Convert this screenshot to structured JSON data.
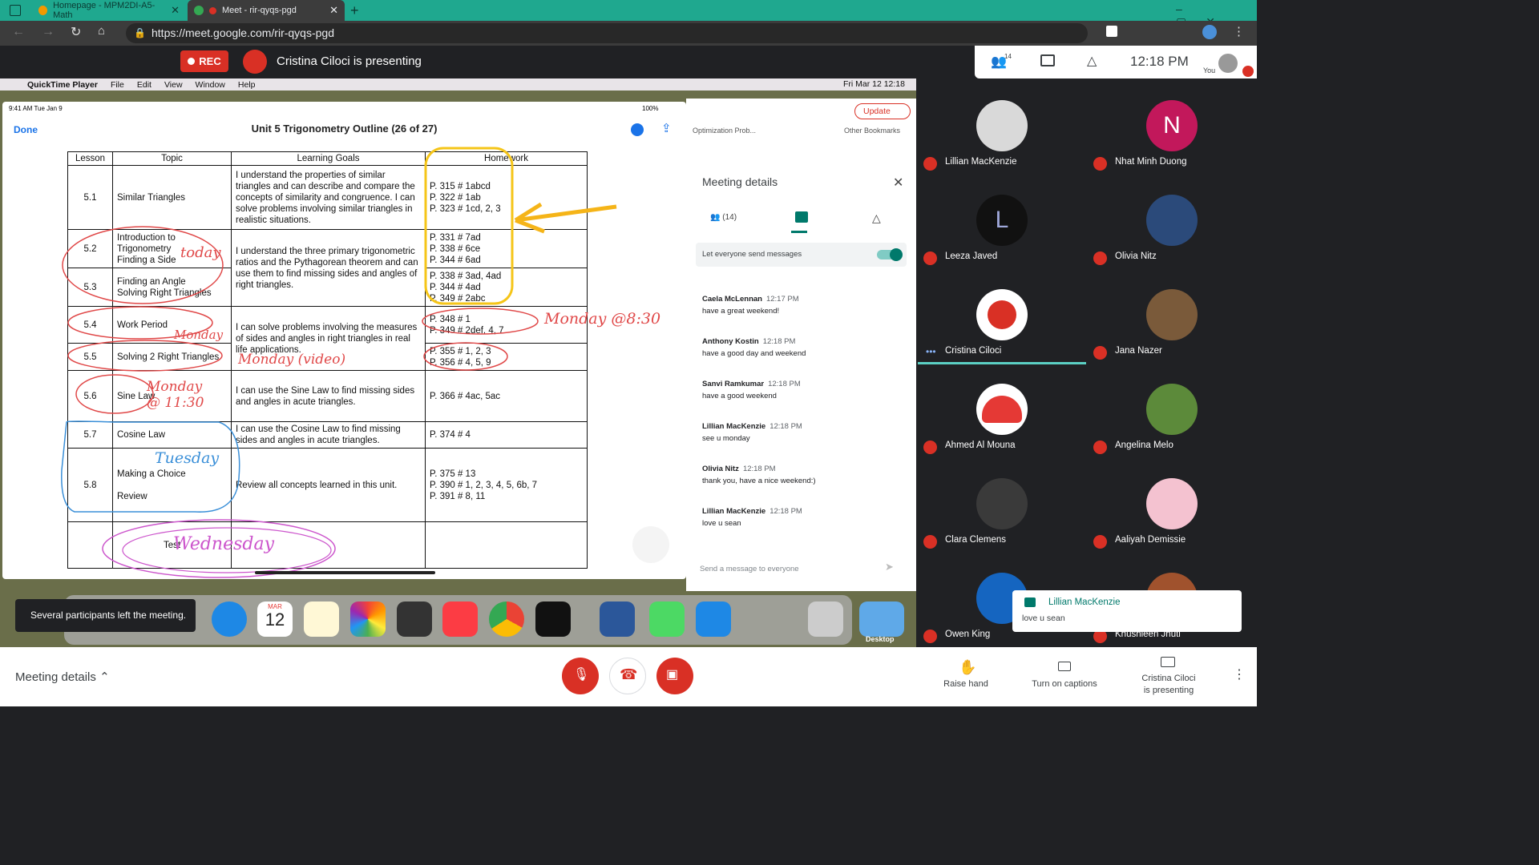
{
  "browser": {
    "tabs": [
      {
        "label": "Homepage - MPM2DI-A5-Math",
        "active": false
      },
      {
        "label": "Meet - rir-qyqs-pgd",
        "active": true
      }
    ],
    "url": "https://meet.google.com/rir-qyqs-pgd"
  },
  "meet_header": {
    "rec_label": "REC",
    "presenting_text": "Cristina Ciloci is presenting",
    "participant_count": "14",
    "time": "12:18 PM",
    "you_label": "You"
  },
  "mac_menubar": {
    "items": [
      "QuickTime Player",
      "File",
      "Edit",
      "View",
      "Window",
      "Help"
    ],
    "datetime": "Fri Mar 12  12:18"
  },
  "ipad": {
    "status_time": "9:41 AM",
    "status_date": "Tue Jan 9",
    "battery": "100%",
    "done_label": "Done",
    "doc_title": "Unit 5 Trigonometry Outline (26 of 27)"
  },
  "doc_table": {
    "headers": [
      "Lesson",
      "Topic",
      "Learning Goals",
      "Homework"
    ],
    "rows": [
      {
        "lesson": "5.1",
        "topic": "Similar Triangles",
        "goals": "I understand the properties of similar triangles and can describe and compare the concepts of similarity and congruence. I can solve problems involving similar triangles in realistic situations.",
        "homework": "P. 315 # 1abcd\nP. 322 # 1ab\nP. 323 # 1cd, 2, 3"
      },
      {
        "lesson": "5.2",
        "topic": "Introduction to Trigonometry\nFinding a Side",
        "goals": "I understand the three primary trigonometric ratios and the Pythagorean theorem and can use them to find missing sides and angles of right triangles.",
        "homework": "P. 331 # 7ad\nP. 338 # 6ce\nP. 344 # 6ad"
      },
      {
        "lesson": "5.3",
        "topic": "Finding an Angle\nSolving Right Triangles",
        "goals": "",
        "homework": "P. 338 # 3ad, 4ad\nP. 344 # 4ad\nP. 349 # 2abc"
      },
      {
        "lesson": "5.4",
        "topic": "Work Period",
        "goals": "I can solve problems involving the measures of sides and angles in right triangles in real life applications.",
        "homework": "P. 348 # 1\nP. 349 # 2def, 4, 7"
      },
      {
        "lesson": "5.5",
        "topic": "Solving 2 Right Triangles",
        "goals": "",
        "homework": "P. 355 # 1, 2, 3\nP. 356 # 4, 5, 9"
      },
      {
        "lesson": "5.6",
        "topic": "Sine Law",
        "goals": "I can use the Sine Law to find missing sides and angles in acute triangles.",
        "homework": "P. 366 # 4ac, 5ac"
      },
      {
        "lesson": "5.7",
        "topic": "Cosine Law",
        "goals": "I can use the Cosine Law to find missing sides and angles in acute triangles.",
        "homework": "P. 374 # 4"
      },
      {
        "lesson": "5.8",
        "topic": "Making a Choice\n\nReview",
        "goals": "Review all concepts learned in this unit.",
        "homework": "P. 375 # 13\nP. 390 # 1, 2, 3, 4, 5, 6b, 7\nP. 391 # 8, 11"
      },
      {
        "lesson": "",
        "topic": "Test",
        "goals": "",
        "homework": ""
      }
    ]
  },
  "annotations": {
    "today": "today",
    "monday_830": "Monday @8:30",
    "monday_small": "Monday",
    "monday_video": "Monday (video)",
    "monday_1130": "Monday @ 11:30",
    "tuesday": "Tuesday",
    "wednesday": "Wednesday"
  },
  "browser_overlay": {
    "update_label": "Update",
    "bookmark1": "Optimization Prob...",
    "bookmark2": "Other Bookmarks"
  },
  "meeting_details": {
    "title": "Meeting details",
    "people_tab": "(14)",
    "toggle_label": "Let everyone send messages",
    "messages": [
      {
        "name": "Caela McLennan",
        "time": "12:17 PM",
        "text": "have a great weekend!"
      },
      {
        "name": "Anthony Kostin",
        "time": "12:18 PM",
        "text": "have a good day and weekend"
      },
      {
        "name": "Sanvi Ramkumar",
        "time": "12:18 PM",
        "text": "have a good weekend"
      },
      {
        "name": "Lillian MacKenzie",
        "time": "12:18 PM",
        "text": "see u monday"
      },
      {
        "name": "Olivia Nitz",
        "time": "12:18 PM",
        "text": "thank you, have a nice weekend:)"
      },
      {
        "name": "Lillian MacKenzie",
        "time": "12:18 PM",
        "text": "love u sean"
      }
    ],
    "input_placeholder": "Send a message to everyone"
  },
  "dock": {
    "calendar_month": "MAR",
    "calendar_day": "12",
    "desktop_label": "Desktop"
  },
  "toast": "Several participants left the meeting.",
  "participants": [
    {
      "name": "Lillian MacKenzie",
      "initial": "",
      "color": "#d9d9d9"
    },
    {
      "name": "Nhat Minh Duong",
      "initial": "N",
      "color": "#c2185b"
    },
    {
      "name": "Leeza Javed",
      "initial": "L",
      "color": "#111111"
    },
    {
      "name": "Olivia Nitz",
      "initial": "",
      "color": "#2b4a7a"
    },
    {
      "name": "Cristina Ciloci",
      "initial": "",
      "color": "#ffffff"
    },
    {
      "name": "Jana Nazer",
      "initial": "",
      "color": "#7a5a3a"
    },
    {
      "name": "Ahmed Al Mouna",
      "initial": "",
      "color": "#e53935"
    },
    {
      "name": "Angelina Melo",
      "initial": "",
      "color": "#5c8a3a"
    },
    {
      "name": "Clara Clemens",
      "initial": "",
      "color": "#3a3a3a"
    },
    {
      "name": "Aaliyah Demissie",
      "initial": "",
      "color": "#f4c2d0"
    },
    {
      "name": "Owen King",
      "initial": "",
      "color": "#1565c0"
    },
    {
      "name": "Khushleen Jhuti",
      "initial": "",
      "color": "#a0522d"
    }
  ],
  "chat_popup": {
    "name": "Lillian MacKenzie",
    "text": "love u sean"
  },
  "bottom": {
    "meeting_details": "Meeting details",
    "raise_hand": "Raise hand",
    "captions": "Turn on captions",
    "presenting": "Cristina Ciloci\nis presenting"
  },
  "colors": {
    "accent_teal": "#1fa88f",
    "red": "#d93025",
    "meet_dark": "#202124"
  }
}
